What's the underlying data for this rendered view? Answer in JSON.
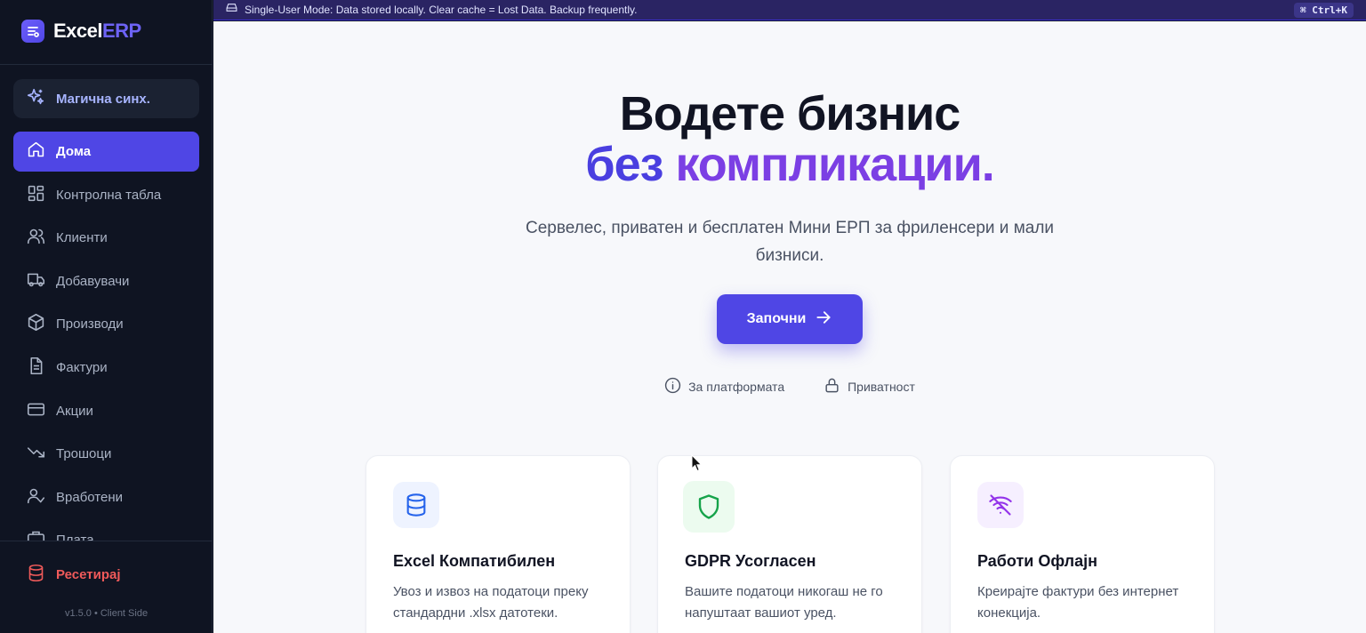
{
  "brand": {
    "name_main": "Excel",
    "name_accent": "ERP",
    "accent_color": "#4f46e5"
  },
  "sidebar": {
    "magic_sync": "Магична синх.",
    "items": [
      {
        "label": "Дома",
        "icon": "home-icon",
        "active": true
      },
      {
        "label": "Контролна табла",
        "icon": "dashboard-icon"
      },
      {
        "label": "Клиенти",
        "icon": "users-icon"
      },
      {
        "label": "Добавувачи",
        "icon": "truck-icon"
      },
      {
        "label": "Производи",
        "icon": "box-icon"
      },
      {
        "label": "Фактури",
        "icon": "file-text-icon"
      },
      {
        "label": "Акции",
        "icon": "credit-card-icon"
      },
      {
        "label": "Трошоци",
        "icon": "trending-down-icon"
      },
      {
        "label": "Вработени",
        "icon": "user-check-icon"
      },
      {
        "label": "Плата",
        "icon": "briefcase-icon"
      }
    ],
    "reset_label": "Ресетирај",
    "version": "v1.5.0 • Client Side"
  },
  "banner": {
    "text": "Single-User Mode: Data stored locally. Clear cache = Lost Data. Backup frequently.",
    "shortcut": "⌘ Ctrl+K"
  },
  "hero": {
    "line1": "Водете бизнис",
    "line2_word1": "без",
    "line2_word2": "компликации.",
    "subtitle": "Сервелес, приватен и бесплатен Мини ЕРП за фриленсери и мали бизниси.",
    "cta_label": "Започни"
  },
  "links": {
    "about": "За платформата",
    "privacy": "Приватност"
  },
  "cards": [
    {
      "title": "Excel Компатибилен",
      "desc": "Увоз и извоз на податоци преку стандардни .xlsx датотеки.",
      "icon": "database-icon",
      "color": "#2563eb"
    },
    {
      "title": "GDPR Усогласен",
      "desc": "Вашите податоци никогаш не го напуштаат вашиот уред.",
      "icon": "shield-icon",
      "color": "#16a34a"
    },
    {
      "title": "Работи Офлајн",
      "desc": "Креирајте фактури без интернет конекција.",
      "icon": "wifi-off-icon",
      "color": "#9333ea"
    }
  ]
}
